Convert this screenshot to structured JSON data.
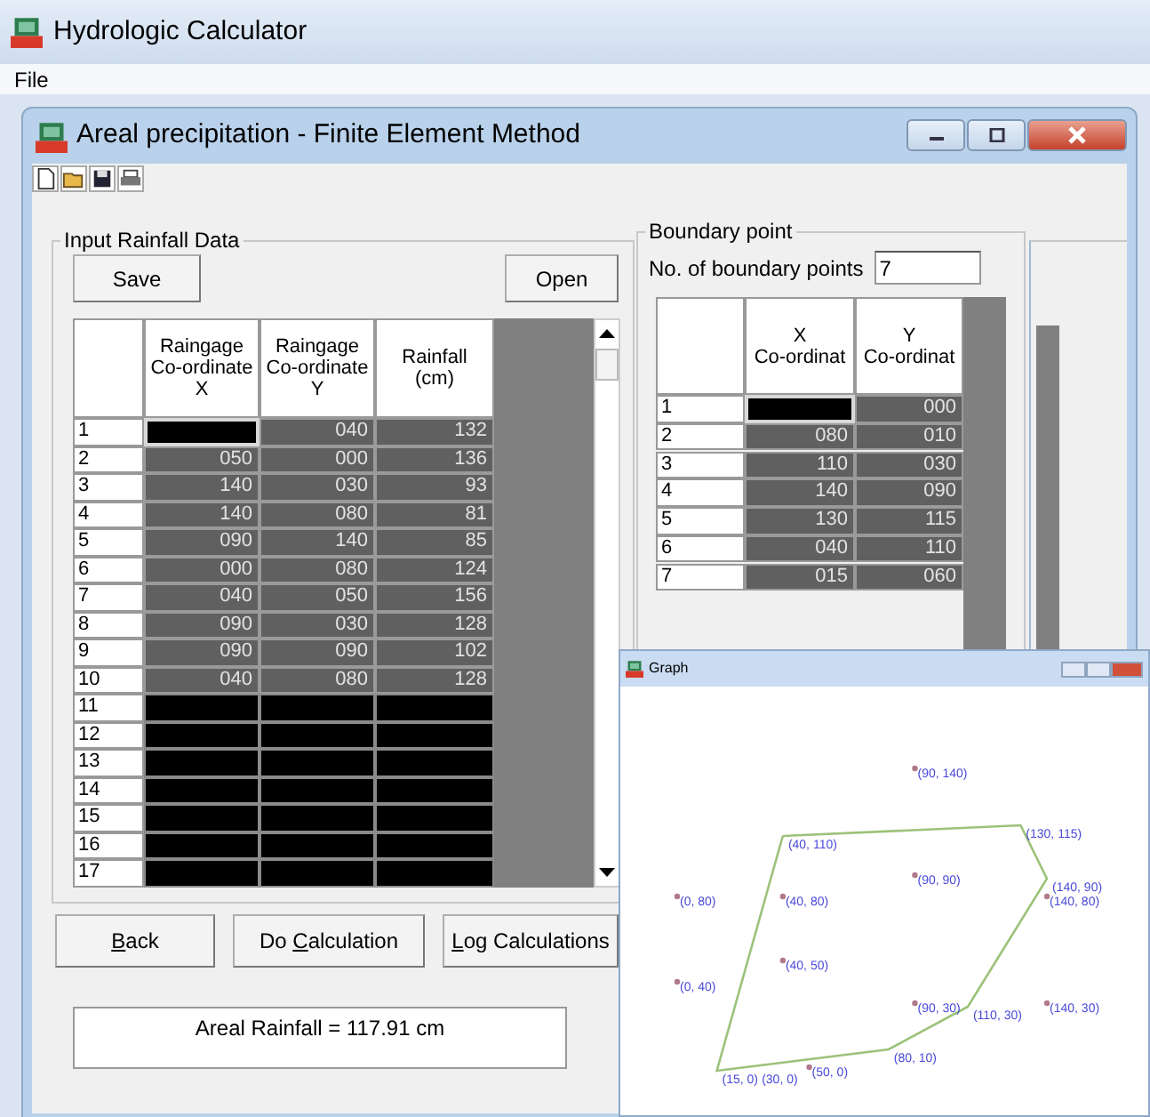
{
  "app": {
    "title": "Hydrologic Calculator",
    "menu": [
      "File"
    ]
  },
  "child_window": {
    "title": "Areal precipitation - Finite Element Method"
  },
  "toolbar": [
    {
      "kind": "new"
    },
    {
      "kind": "open"
    },
    {
      "kind": "save"
    },
    {
      "kind": "print"
    }
  ],
  "rainfall_group": {
    "title": "Input Rainfall Data",
    "buttons": [
      "Save",
      "Open"
    ],
    "columns": [
      "Raingage\nCo-ordinate\nX",
      "Raingage\nCo-ordinate\nY",
      "Rainfall\n(cm)"
    ],
    "rows": [
      {
        "number": "1",
        "cells": [
          null,
          "040",
          "132"
        ]
      },
      {
        "number": "2",
        "cells": [
          "050",
          "000",
          "136"
        ]
      },
      {
        "number": "3",
        "cells": [
          "140",
          "030",
          "93"
        ]
      },
      {
        "number": "4",
        "cells": [
          "140",
          "080",
          "81"
        ]
      },
      {
        "number": "5",
        "cells": [
          "090",
          "140",
          "85"
        ]
      },
      {
        "number": "6",
        "cells": [
          "000",
          "080",
          "124"
        ]
      },
      {
        "number": "7",
        "cells": [
          "040",
          "050",
          "156"
        ]
      },
      {
        "number": "8",
        "cells": [
          "090",
          "030",
          "128"
        ]
      },
      {
        "number": "9",
        "cells": [
          "090",
          "090",
          "102"
        ]
      },
      {
        "number": "10",
        "cells": [
          "040",
          "080",
          "128"
        ]
      },
      {
        "number": "11"
      },
      {
        "number": "12"
      },
      {
        "number": "13"
      },
      {
        "number": "14"
      },
      {
        "number": "15"
      },
      {
        "number": "16"
      },
      {
        "number": "17"
      }
    ]
  },
  "actions": [
    {
      "key": "B",
      "post": "ack"
    },
    {
      "pre": "Do ",
      "key": "C",
      "post": "alculation"
    },
    {
      "key": "L",
      "post": "og Calculations"
    }
  ],
  "result": "Areal Rainfall = 117.91 cm",
  "boundary_group": {
    "title": "Boundary point",
    "count_label": "No. of boundary points",
    "count_value": "7",
    "columns": [
      "X\nCo-ordinat",
      "Y\nCo-ordinat"
    ],
    "rows": [
      {
        "number": "1",
        "cells": [
          null,
          "000"
        ]
      },
      {
        "number": "2",
        "cells": [
          "080",
          "010"
        ]
      },
      {
        "number": "3",
        "cells": [
          "110",
          "030"
        ]
      },
      {
        "number": "4",
        "cells": [
          "140",
          "090"
        ]
      },
      {
        "number": "5",
        "cells": [
          "130",
          "115"
        ]
      },
      {
        "number": "6",
        "cells": [
          "040",
          "110"
        ]
      },
      {
        "number": "7",
        "cells": [
          "015",
          "060"
        ]
      }
    ]
  },
  "graph_window": {
    "title": "Graph",
    "point_labels": [
      {
        "kind": "gage",
        "text": "(90, 140)"
      },
      {
        "kind": "vertex",
        "text": "(40, 110)"
      },
      {
        "kind": "vertex",
        "text": "(130, 115)"
      },
      {
        "kind": "gage",
        "text": "(90, 90)"
      },
      {
        "kind": "vertex",
        "text": "(140, 90)"
      },
      {
        "kind": "gage",
        "text": "(0, 80)"
      },
      {
        "kind": "gage",
        "text": "(40, 80)"
      },
      {
        "kind": "gage",
        "text": "(140, 80)"
      },
      {
        "kind": "gage",
        "text": "(40, 50)"
      },
      {
        "kind": "gage",
        "text": "(0, 40)"
      },
      {
        "kind": "gage",
        "text": "(90, 30)"
      },
      {
        "kind": "vertex",
        "text": "(110, 30)"
      },
      {
        "kind": "gage",
        "text": "(140, 30)"
      },
      {
        "kind": "vertex",
        "text": "(80, 10)"
      },
      {
        "kind": "vertex",
        "text": "(15, 0)"
      },
      {
        "kind": "vertex",
        "text": "(30, 0)"
      },
      {
        "kind": "gage",
        "text": "(50, 0)"
      }
    ]
  }
}
